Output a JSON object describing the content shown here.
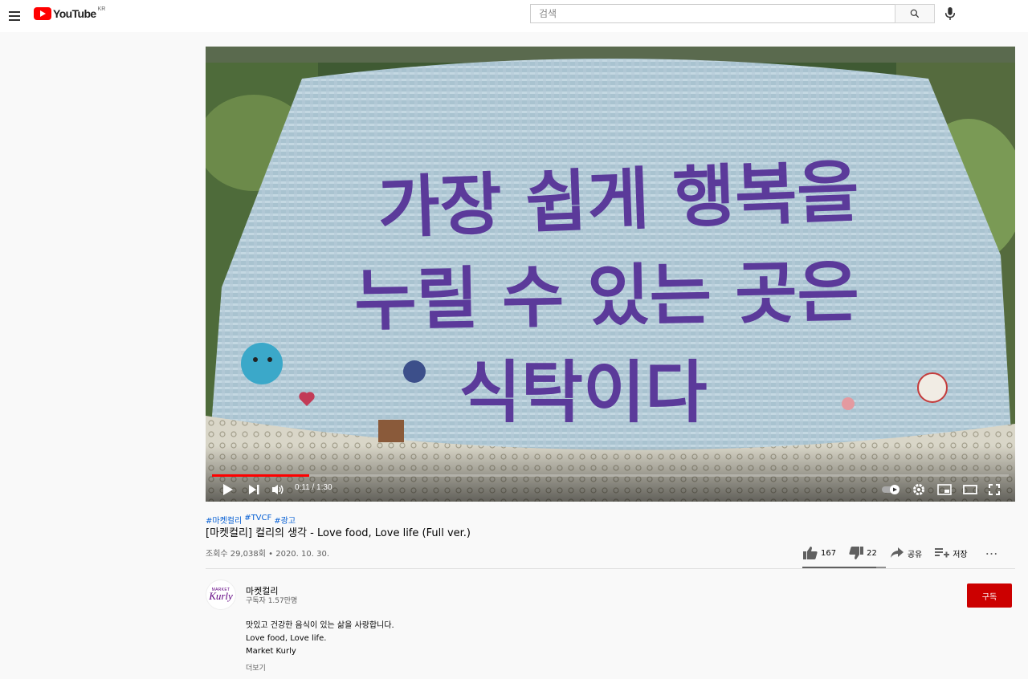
{
  "header": {
    "logo_text": "YouTube",
    "region": "KR",
    "search_placeholder": "검색"
  },
  "player": {
    "overlay_lines": [
      "가장 쉽게 행복을",
      "누릴 수 있는 곳은",
      "식탁이다"
    ],
    "time_display": "0:11 / 1:30",
    "progress_fraction": 0.122
  },
  "video": {
    "tags": [
      "#마켓컬리",
      "#TVCF",
      "#광고"
    ],
    "title": "[마켓컬리] 컬리의 생각 - Love food, Love life (Full ver.)",
    "meta": "조회수 29,038회 • 2020. 10. 30.",
    "likes": "167",
    "dislikes": "22",
    "share_label": "공유",
    "save_label": "저장",
    "more_icon": "⋯"
  },
  "channel": {
    "avatar_small_text": "MARKET",
    "avatar_wordmark": "Kurly",
    "name": "마켓컬리",
    "subscribers": "구독자 1.57만명",
    "subscribe_label": "구독",
    "description": [
      "맛있고 건강한 음식이 있는 삶을 사랑합니다.",
      "Love food, Love life.",
      "Market Kurly"
    ],
    "more_label": "더보기"
  },
  "colors": {
    "brand_red": "#ff0000",
    "subscribe_red": "#cc0000",
    "link_blue": "#065fd4",
    "kurly_purple": "#5f0080",
    "banner_text_purple": "#5b3a9a"
  }
}
